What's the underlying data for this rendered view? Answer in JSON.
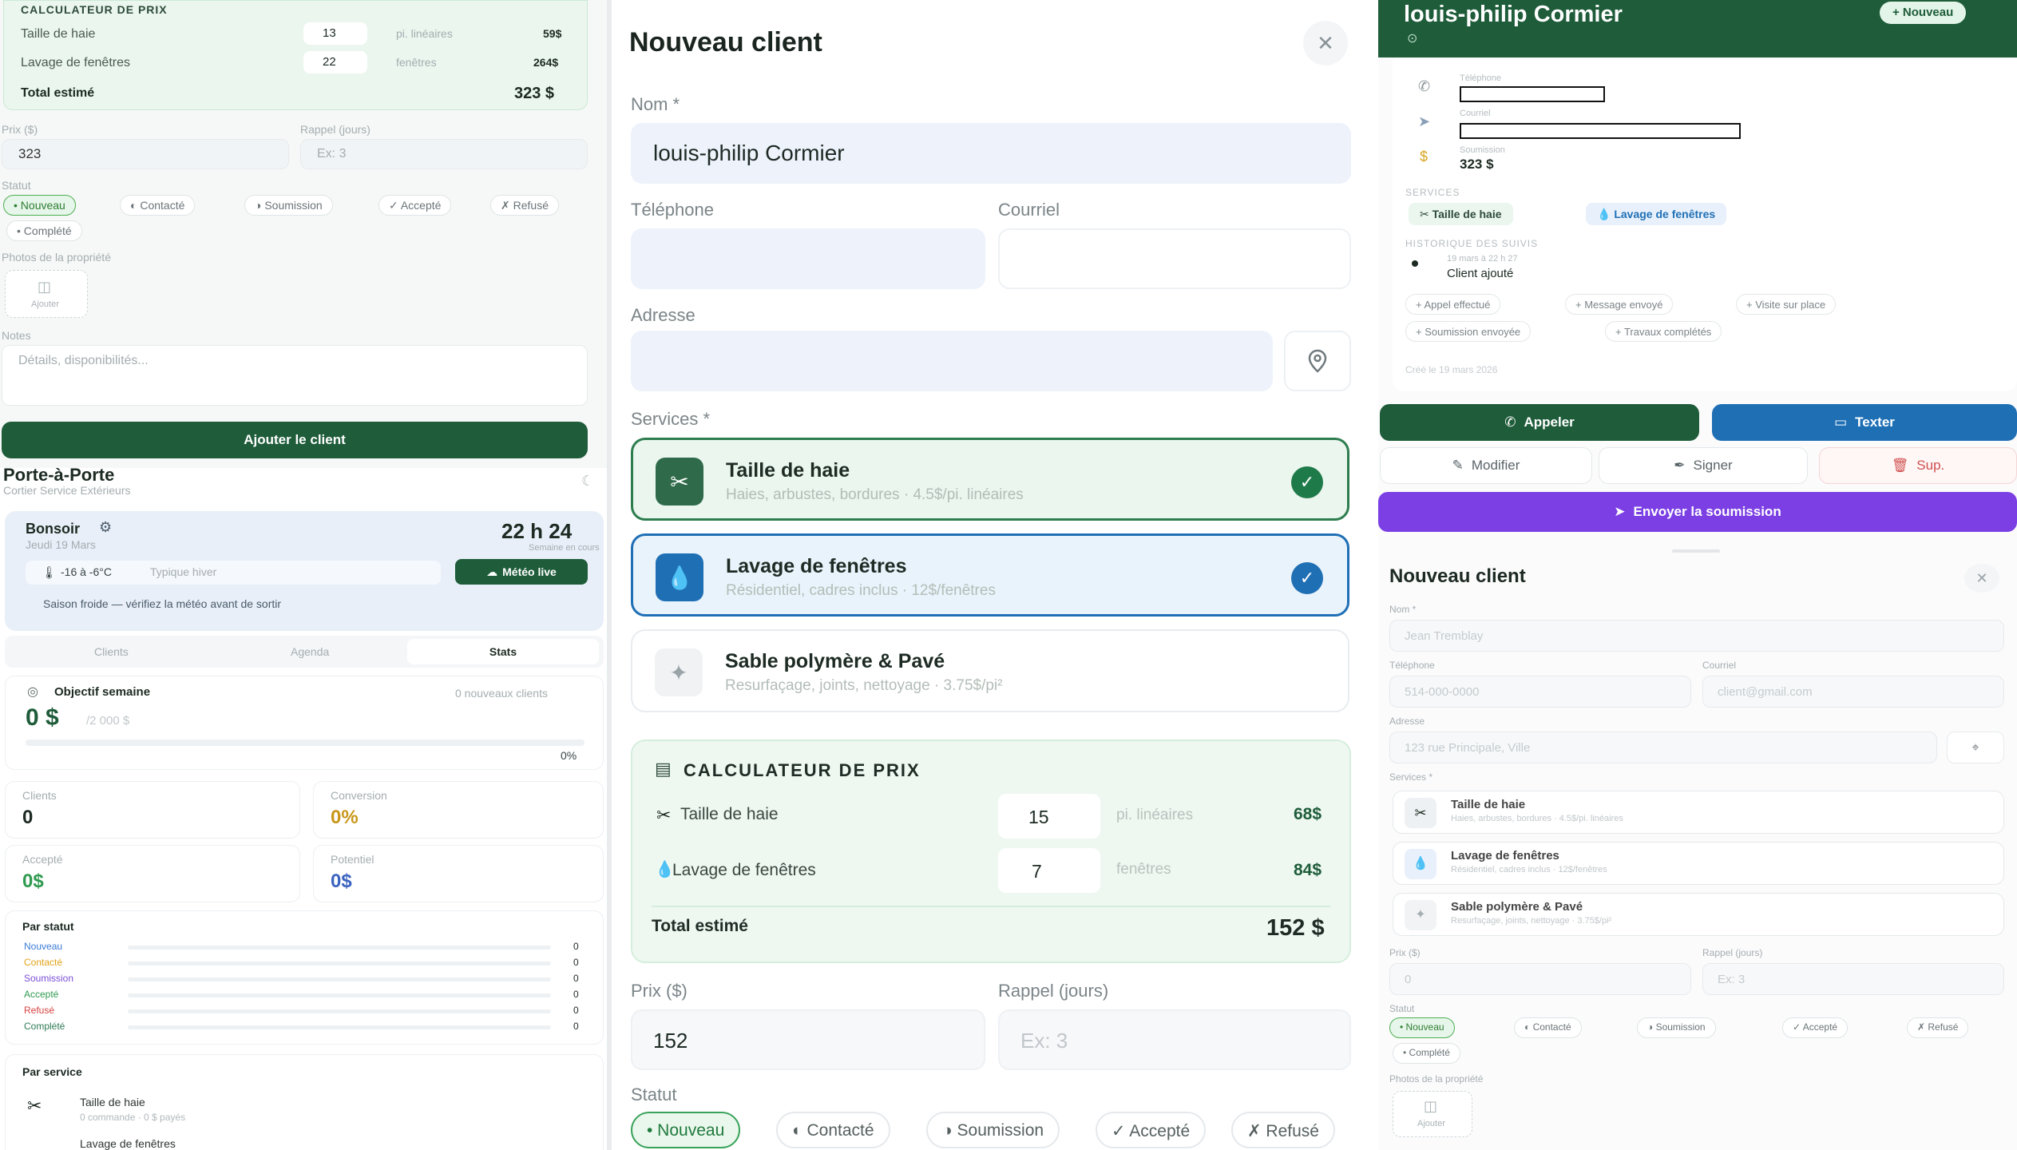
{
  "left": {
    "calc_title": "CALCULATEUR DE PRIX",
    "calc_rows": [
      {
        "label": "Taille de haie",
        "qty": "13",
        "unit": "pi. linéaires",
        "price": "59$"
      },
      {
        "label": "Lavage de fenêtres",
        "qty": "22",
        "unit": "fenêtres",
        "price": "264$"
      }
    ],
    "calc_total_label": "Total estimé",
    "calc_total": "323 $",
    "prix_label": "Prix ($)",
    "prix_value": "323",
    "rappel_label": "Rappel (jours)",
    "rappel_placeholder": "Ex: 3",
    "statut_label": "Statut",
    "status_chips": [
      "• Nouveau",
      "◐ Contacté",
      "◑ Soumission",
      "✓ Accepté",
      "✗ Refusé",
      "• Complété"
    ],
    "photos_label": "Photos de la propriété",
    "photo_btn": "Ajouter",
    "notes_label": "Notes",
    "notes_placeholder": "Détails, disponibilités...",
    "add_button": "Ajouter le client",
    "app_title": "Porte-à-Porte",
    "app_subtitle": "Cortier Service Extérieurs",
    "greeting": "Bonsoir",
    "date": "Jeudi 19 Mars",
    "time": "22 h 24",
    "time_sub": "Semaine en cours",
    "weather": "-16 à -6°C",
    "weather_desc": "Typique hiver",
    "weather_btn": "Météo live",
    "season_note": "Saison froide — vérifiez la météo avant de sortir",
    "tabs": [
      "Clients",
      "Agenda",
      "Stats"
    ],
    "goal_title": "Objectif semaine",
    "goal_sub": "0 nouveaux clients",
    "goal_value": "0 $",
    "goal_target": "/2 000 $",
    "goal_pct": "0%",
    "stats": [
      {
        "label": "Clients",
        "value": "0"
      },
      {
        "label": "Conversion",
        "value": "0%"
      },
      {
        "label": "Accepté",
        "value": "0$"
      },
      {
        "label": "Potentiel",
        "value": "0$"
      }
    ],
    "par_statut": "Par statut",
    "statut_rows": [
      {
        "label": "Nouveau",
        "value": "0",
        "color": "#3b7bd6"
      },
      {
        "label": "Contacté",
        "value": "0",
        "color": "#e0a21a"
      },
      {
        "label": "Soumission",
        "value": "0",
        "color": "#7a4fd6"
      },
      {
        "label": "Accepté",
        "value": "0",
        "color": "#2f9a4f"
      },
      {
        "label": "Refusé",
        "value": "0",
        "color": "#d64040"
      },
      {
        "label": "Complété",
        "value": "0",
        "color": "#2f7a55"
      }
    ],
    "par_service": "Par service",
    "service_rows": [
      {
        "label": "Taille de haie",
        "sub": "0 commande · 0 $ payés"
      },
      {
        "label": "Lavage de fenêtres",
        "sub": ""
      }
    ]
  },
  "mid": {
    "title": "Nouveau client",
    "nom_label": "Nom *",
    "nom_value": "louis-philip Cormier",
    "tel_label": "Téléphone",
    "courriel_label": "Courriel",
    "adresse_label": "Adresse",
    "services_label": "Services *",
    "services": [
      {
        "title": "Taille de haie",
        "sub": "Haies, arbustes, bordures · 4.5$/pi. linéaires",
        "selected": true
      },
      {
        "title": "Lavage de fenêtres",
        "sub": "Résidentiel, cadres inclus · 12$/fenêtres",
        "selected": true
      },
      {
        "title": "Sable polymère & Pavé",
        "sub": "Resurfaçage, joints, nettoyage · 3.75$/pi²",
        "selected": false
      }
    ],
    "calc_title": "CALCULATEUR DE PRIX",
    "calc_rows": [
      {
        "label": "Taille de haie",
        "qty": "15",
        "unit": "pi. linéaires",
        "price": "68$"
      },
      {
        "label": "Lavage de fenêtres",
        "qty": "7",
        "unit": "fenêtres",
        "price": "84$"
      }
    ],
    "total_label": "Total estimé",
    "total_value": "152 $",
    "prix_label": "Prix ($)",
    "prix_value": "152",
    "rappel_label": "Rappel (jours)",
    "rappel_placeholder": "Ex: 3",
    "statut_label": "Statut",
    "status_chips": [
      "• Nouveau",
      "◐ Contacté",
      "◑ Soumission",
      "✓ Accepté",
      "✗ Refusé"
    ]
  },
  "right": {
    "client_name": "louis-philip Cormier",
    "new_badge": "+ Nouveau",
    "tel_label": "Téléphone",
    "courriel_label": "Courriel",
    "soumission_label": "Soumission",
    "soumission_value": "323 $",
    "services_label": "SERVICES",
    "service_tags": [
      "Taille de haie",
      "Lavage de fenêtres"
    ],
    "history_label": "HISTORIQUE DES SUIVIS",
    "history_date": "19 mars à 22 h 27",
    "history_text": "Client ajouté",
    "action_chips": [
      "+ Appel effectué",
      "+ Message envoyé",
      "+ Visite sur place",
      "+ Soumission envoyée",
      "+ Travaux complétés"
    ],
    "created": "Créé le 19 mars 2026",
    "btn_call": "Appeler",
    "btn_text": "Texter",
    "btn_edit": "Modifier",
    "btn_sign": "Signer",
    "btn_delete": "Sup.",
    "btn_send": "Envoyer la soumission",
    "form_title": "Nouveau client",
    "nom_label": "Nom *",
    "nom_placeholder": "Jean Tremblay",
    "tel_label2": "Téléphone",
    "tel_placeholder": "514-000-0000",
    "courriel_label2": "Courriel",
    "courriel_placeholder": "client@gmail.com",
    "adresse_label": "Adresse",
    "adresse_placeholder": "123 rue Principale, Ville",
    "services_label2": "Services *",
    "services": [
      {
        "title": "Taille de haie",
        "sub": "Haies, arbustes, bordures · 4.5$/pi. linéaires"
      },
      {
        "title": "Lavage de fenêtres",
        "sub": "Résidentiel, cadres inclus · 12$/fenêtres"
      },
      {
        "title": "Sable polymère & Pavé",
        "sub": "Resurfaçage, joints, nettoyage · 3.75$/pi²"
      }
    ],
    "prix_label": "Prix ($)",
    "prix_placeholder": "0",
    "rappel_label": "Rappel (jours)",
    "rappel_placeholder": "Ex: 3",
    "statut_label": "Statut",
    "status_chips": [
      "• Nouveau",
      "◐ Contacté",
      "◑ Soumission",
      "✓ Accepté",
      "✗ Refusé",
      "• Complété"
    ],
    "photos_label": "Photos de la propriété",
    "photo_btn": "Ajouter"
  },
  "colors": {
    "brand_green": "#1e5c3a",
    "blue": "#1f6fb5",
    "purple": "#7b3fe4",
    "check_green": "#1f7a4a"
  }
}
